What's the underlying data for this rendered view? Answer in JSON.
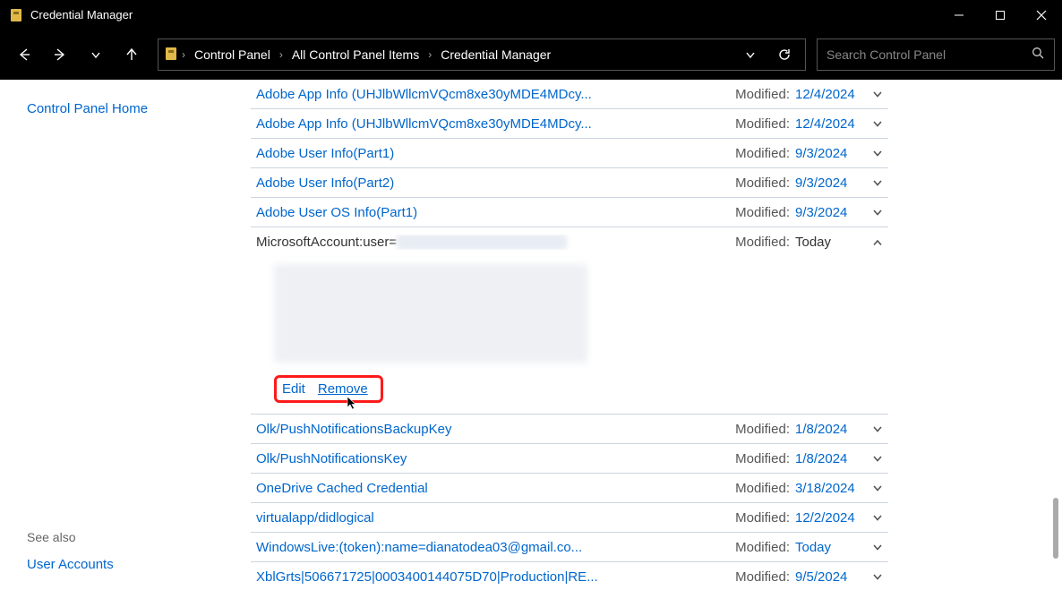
{
  "window": {
    "title": "Credential Manager"
  },
  "breadcrumbs": [
    "Control Panel",
    "All Control Panel Items",
    "Credential Manager"
  ],
  "search": {
    "placeholder": "Search Control Panel"
  },
  "sidebar": {
    "home": "Control Panel Home",
    "see_also_header": "See also",
    "see_also_links": [
      "User Accounts"
    ]
  },
  "labels": {
    "modified": "Modified:",
    "edit": "Edit",
    "remove": "Remove"
  },
  "credentials": [
    {
      "name": "Adobe App Info (UHJlbWllcmVQcm8xe30yMDE4MDcy...",
      "date": "12/4/2024",
      "expanded": false
    },
    {
      "name": "Adobe App Info (UHJlbWllcmVQcm8xe30yMDE4MDcy...",
      "date": "12/4/2024",
      "expanded": false
    },
    {
      "name": "Adobe User Info(Part1)",
      "date": "9/3/2024",
      "expanded": false
    },
    {
      "name": "Adobe User Info(Part2)",
      "date": "9/3/2024",
      "expanded": false
    },
    {
      "name": "Adobe User OS Info(Part1)",
      "date": "9/3/2024",
      "expanded": false
    },
    {
      "name": "MicrosoftAccount:user=",
      "date": "Today",
      "expanded": true
    },
    {
      "name": "Olk/PushNotificationsBackupKey",
      "date": "1/8/2024",
      "expanded": false
    },
    {
      "name": "Olk/PushNotificationsKey",
      "date": "1/8/2024",
      "expanded": false
    },
    {
      "name": "OneDrive Cached Credential",
      "date": "3/18/2024",
      "expanded": false
    },
    {
      "name": "virtualapp/didlogical",
      "date": "12/2/2024",
      "expanded": false
    },
    {
      "name": "WindowsLive:(token):name=dianatodea03@gmail.co...",
      "date": "Today",
      "expanded": false
    },
    {
      "name": "XblGrts|506671725|0003400144075D70|Production|RE...",
      "date": "9/5/2024",
      "expanded": false
    }
  ]
}
